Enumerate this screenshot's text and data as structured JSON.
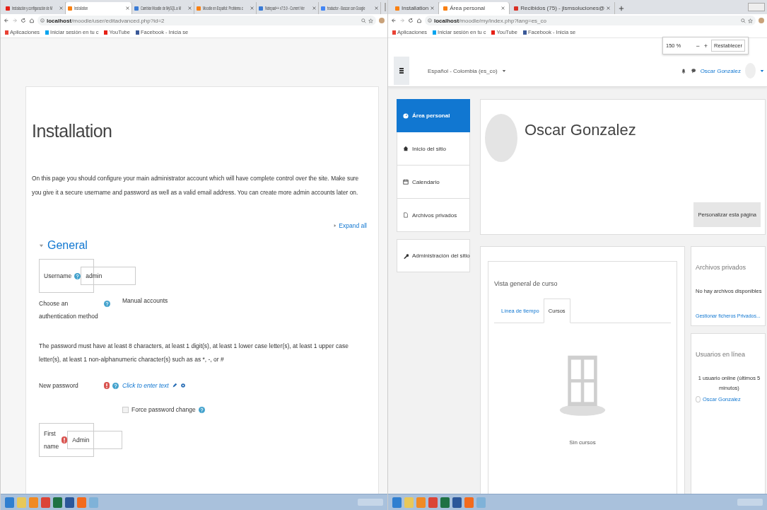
{
  "left_browser": {
    "tabs": [
      {
        "title": "Instalación y configuración de M",
        "selected": false,
        "kind": "video"
      },
      {
        "title": "Installation",
        "selected": true,
        "kind": "moodle"
      },
      {
        "title": "Cambiar Moodle de MySQL a M",
        "selected": false,
        "kind": "page"
      },
      {
        "title": "Moodle en Español: Problema c",
        "selected": false,
        "kind": "moodle"
      },
      {
        "title": "Notepad++ v7.5.9 - Current Ver",
        "selected": false,
        "kind": "page"
      },
      {
        "title": "traductor - Buscar con Google",
        "selected": false,
        "kind": "google"
      }
    ],
    "address": "**localhost**/moodle/user/editadvanced.php?id=2",
    "bookmarks": [
      {
        "label": "Aplicaciones",
        "kind": "apps"
      },
      {
        "label": "Iniciar sesión en tu c",
        "kind": "windows"
      },
      {
        "label": "YouTube",
        "kind": "video"
      },
      {
        "label": "Facebook - Inicia se",
        "kind": "facebook"
      }
    ],
    "page": {
      "title": "Installation",
      "intro": "On this page you should configure your main administrator account which will have complete control over the site. Make sure you give it a secure username and password as well as a valid email address. You can create more admin accounts later on.",
      "expand_all": "Expand all",
      "section": "General",
      "section_expanded": true,
      "fields": [
        {
          "kind": "input",
          "label": "Username",
          "required": false,
          "help": true,
          "value": "admin"
        },
        {
          "kind": "static",
          "label": "Choose an authentication method",
          "required": false,
          "help": true,
          "value": "Manual accounts"
        },
        {
          "kind": "note",
          "text": "The password must have at least 8 characters, at least 1 digit(s), at least 1 lower case letter(s), at least 1 upper case letter(s), at least 1 non-alphanumeric character(s) such as as *, -, or #"
        },
        {
          "kind": "password",
          "label": "New password",
          "required": true,
          "help": true,
          "value": "Click to enter text"
        },
        {
          "kind": "checkbox",
          "label": "Force password change",
          "checked": false,
          "help": true
        },
        {
          "kind": "input",
          "label": "First name",
          "required": true,
          "help": false,
          "value": "Admin"
        }
      ]
    }
  },
  "right_browser": {
    "tabs": [
      {
        "title": "Installation",
        "selected": false,
        "kind": "moodle"
      },
      {
        "title": "Área personal",
        "selected": true,
        "kind": "moodle"
      },
      {
        "title": "Recibidos (75) - jlsmsoluciones@",
        "selected": false,
        "kind": "mail"
      }
    ],
    "address": "**localhost**/moodle/my/index.php?lang=es_co",
    "bookmarks": [
      {
        "label": "Aplicaciones",
        "kind": "apps"
      },
      {
        "label": "Iniciar sesión en tu c",
        "kind": "windows"
      },
      {
        "label": "YouTube",
        "kind": "video"
      },
      {
        "label": "Facebook - Inicia se",
        "kind": "facebook"
      }
    ],
    "zoom_popup": {
      "value": "150 %",
      "minus": "−",
      "plus": "+",
      "reset": "Restablecer"
    },
    "navbar": {
      "language": "Español - Colombia (es_co)",
      "user": "Oscar Gonzalez"
    },
    "sidebar": [
      {
        "label": "Área personal",
        "selected": true,
        "kind": "dashboard"
      },
      {
        "label": "Inicio del sitio",
        "selected": false,
        "kind": "home"
      },
      {
        "label": "Calendario",
        "selected": false,
        "kind": "calendar"
      },
      {
        "label": "Archivos privados",
        "selected": false,
        "kind": "file"
      },
      {
        "label": "Administración del sitio",
        "selected": false,
        "kind": "wrench"
      }
    ],
    "profile": {
      "name": "Oscar Gonzalez",
      "button": "Personalizar esta página"
    },
    "course_overview": {
      "title": "Vista general de curso",
      "tabs": [
        {
          "label": "Línea de tiempo",
          "selected": false
        },
        {
          "label": "Cursos",
          "selected": true
        }
      ],
      "empty": "Sin cursos"
    },
    "blocks": [
      {
        "title": "Archivos privados",
        "lines": [
          {
            "kind": "text",
            "text": "No hay archivos disponibles"
          },
          {
            "kind": "link",
            "text": "Gestionar ficheros Privados..."
          }
        ]
      },
      {
        "title": "Usuarios en línea",
        "lines": [
          {
            "kind": "text",
            "text": "1 usuario online (últimos 5 minutos)"
          },
          {
            "kind": "user",
            "text": "Oscar Gonzalez"
          }
        ]
      }
    ]
  }
}
